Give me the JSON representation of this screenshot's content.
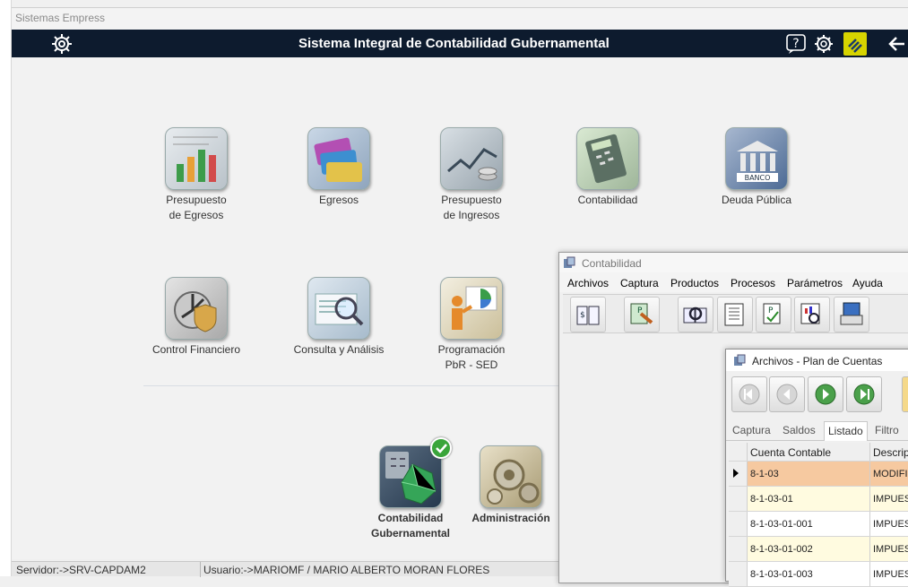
{
  "window": {
    "title": "Sistemas Empress"
  },
  "appbar": {
    "title": "Sistema Integral de Contabilidad Gubernamental",
    "icons": [
      "tools-gear-icon",
      "help-icon",
      "settings-gear-icon",
      "logo-icon",
      "back-arrow-icon"
    ]
  },
  "modules_row1": [
    {
      "label1": "Presupuesto",
      "label2": "de Egresos",
      "icon": "budget-chart-icon"
    },
    {
      "label1": "Egresos",
      "label2": "",
      "icon": "cards-icon"
    },
    {
      "label1": "Presupuesto",
      "label2": "de Ingresos",
      "icon": "coins-chart-icon"
    },
    {
      "label1": "Contabilidad",
      "label2": "",
      "icon": "calculator-icon"
    },
    {
      "label1": "Deuda Pública",
      "label2": "",
      "icon": "bank-icon"
    }
  ],
  "modules_row2": [
    {
      "label1": "Control Financiero",
      "label2": "",
      "icon": "vault-icon"
    },
    {
      "label1": "Consulta y Análisis",
      "label2": "",
      "icon": "magnifier-icon"
    },
    {
      "label1": "Programación",
      "label2": "PbR - SED",
      "icon": "presentation-icon"
    }
  ],
  "modules_row3": [
    {
      "label1": "Contabilidad",
      "label2": "Gubernamental",
      "icon": "accounting-gov-icon",
      "checked": true
    },
    {
      "label1": "Administración",
      "label2": "",
      "icon": "admin-gears-icon"
    }
  ],
  "statusbar": {
    "server": "Servidor:->SRV-CAPDAM2",
    "user": "Usuario:->MARIOMF / MARIO ALBERTO MORAN FLORES"
  },
  "conta_window": {
    "title": "Contabilidad",
    "menu": [
      "Archivos",
      "Captura",
      "Productos",
      "Procesos",
      "Parámetros",
      "Ayuda"
    ],
    "toolbar": [
      "book-icon",
      "capture-p-icon",
      "search-book-icon",
      "calculator-doc-icon",
      "report-p-icon",
      "chart-search-icon",
      "printer-icon"
    ]
  },
  "plan_window": {
    "title": "Archivos - Plan de Cuentas",
    "nav": [
      "first-icon",
      "prev-icon",
      "next-icon",
      "last-icon"
    ],
    "tabs": [
      "Captura",
      "Saldos",
      "Listado",
      "Filtro"
    ],
    "active_tab": "Listado",
    "columns": [
      "Cuenta Contable",
      "Descripc"
    ],
    "rows": [
      {
        "cuenta": "8-1-03",
        "desc": "MODIFIC",
        "selected": true
      },
      {
        "cuenta": "8-1-03-01",
        "desc": "IMPUEST"
      },
      {
        "cuenta": "8-1-03-01-001",
        "desc": "IMPUEST"
      },
      {
        "cuenta": "8-1-03-01-002",
        "desc": "IMPUEST"
      },
      {
        "cuenta": "8-1-03-01-003",
        "desc": "IMPUEST"
      }
    ]
  },
  "colors": {
    "appbar": "#0d1b2e",
    "selected_row": "#f6c9a0",
    "alt_row": "#fffbe0"
  }
}
